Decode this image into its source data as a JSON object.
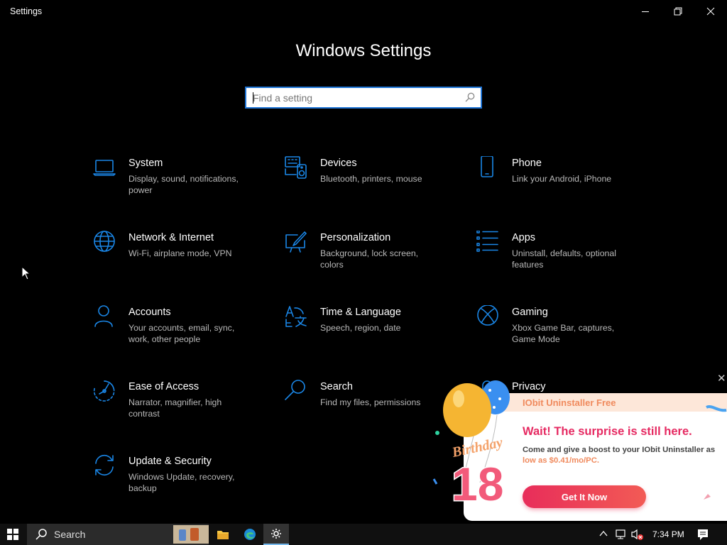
{
  "window": {
    "title": "Settings",
    "minimize_label": "Minimize",
    "maximize_label": "Restore",
    "close_label": "Close"
  },
  "page": {
    "heading": "Windows Settings",
    "search_placeholder": "Find a setting"
  },
  "tiles": [
    {
      "title": "System",
      "desc": "Display, sound, notifications, power",
      "icon": "laptop-icon"
    },
    {
      "title": "Devices",
      "desc": "Bluetooth, printers, mouse",
      "icon": "keyboard-speaker-icon"
    },
    {
      "title": "Phone",
      "desc": "Link your Android, iPhone",
      "icon": "phone-icon"
    },
    {
      "title": "Network & Internet",
      "desc": "Wi-Fi, airplane mode, VPN",
      "icon": "globe-icon"
    },
    {
      "title": "Personalization",
      "desc": "Background, lock screen, colors",
      "icon": "paint-monitor-icon"
    },
    {
      "title": "Apps",
      "desc": "Uninstall, defaults, optional features",
      "icon": "apps-list-icon"
    },
    {
      "title": "Accounts",
      "desc": "Your accounts, email, sync, work, other people",
      "icon": "person-icon"
    },
    {
      "title": "Time & Language",
      "desc": "Speech, region, date",
      "icon": "time-language-icon"
    },
    {
      "title": "Gaming",
      "desc": "Xbox Game Bar, captures, Game Mode",
      "icon": "xbox-icon"
    },
    {
      "title": "Ease of Access",
      "desc": "Narrator, magnifier, high contrast",
      "icon": "ease-of-access-icon"
    },
    {
      "title": "Search",
      "desc": "Find my files, permissions",
      "icon": "search-magnifier-icon"
    },
    {
      "title": "Privacy",
      "desc": "",
      "icon": "lock-icon"
    },
    {
      "title": "Update & Security",
      "desc": "Windows Update, recovery, backup",
      "icon": "sync-arrows-icon"
    }
  ],
  "ad": {
    "brand": "IObit Uninstaller Free",
    "headline": "Wait! The surprise is still here.",
    "body_prefix": "Come and give a boost to your IObit Uninstaller as ",
    "body_highlight": "low as $0.41/mo/PC.",
    "button": "Get It Now",
    "badge_word": "Birthday",
    "badge_number": "18",
    "close_glyph": "✕"
  },
  "taskbar": {
    "search_label": "Search",
    "clock": "7:34 PM",
    "apps": [
      "file-explorer-icon",
      "edge-icon",
      "settings-gear-icon"
    ]
  },
  "colors": {
    "accent": "#1a86e6",
    "ad_pink": "#e62a62",
    "ad_orange": "#f08a5d"
  }
}
